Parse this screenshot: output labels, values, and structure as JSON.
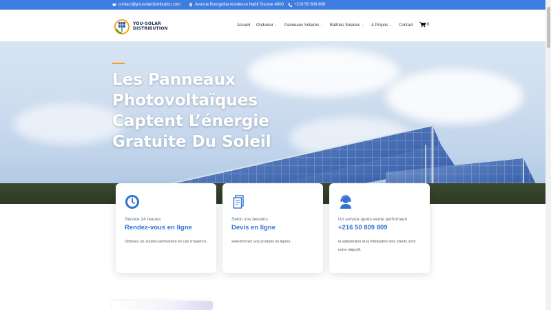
{
  "topbar": {
    "email": "contact@yousolardistribution.com",
    "address": "Avenue Bourguiba résidence Nabil Sousse 4000",
    "phone": "+216 50 809 809",
    "background": "#3f7ee0"
  },
  "brand": {
    "line1": "YOU-SOLAR",
    "line2": "DISTRIBUTION"
  },
  "nav": {
    "items": [
      {
        "label": "Accueil",
        "dropdown": false
      },
      {
        "label": "Onduleur",
        "dropdown": true
      },
      {
        "label": "Panneaux Solaires",
        "dropdown": true
      },
      {
        "label": "Battries Solaires",
        "dropdown": true
      },
      {
        "label": "A Propos",
        "dropdown": true
      },
      {
        "label": "Contact",
        "dropdown": false
      }
    ],
    "cart_count": "0"
  },
  "hero": {
    "title_lines": [
      "Les Panneaux",
      "Photovoltaïques",
      "Captent L’énergie",
      "Gratuite Du Soleil"
    ],
    "accent_color": "#f39c27"
  },
  "cards": [
    {
      "icon": "clock-icon",
      "small": "Service 24 heures",
      "title": "Rendez-vous en ligne",
      "desc": "Obtenez un soutien permanent en cas d'urgence."
    },
    {
      "icon": "document-icon",
      "small": "Selon vos besoins",
      "title": "Devis en ligne",
      "desc": "selectionnez vos produits en lignes."
    },
    {
      "icon": "support-agent-icon",
      "small": "Un service après-vente performant",
      "title": "+216 50 809 809",
      "desc": "la satisfaction et la fidélisation des clients sont notre objectif."
    }
  ],
  "colors": {
    "primary": "#2f72d4",
    "text_muted": "#5b6b7c"
  }
}
